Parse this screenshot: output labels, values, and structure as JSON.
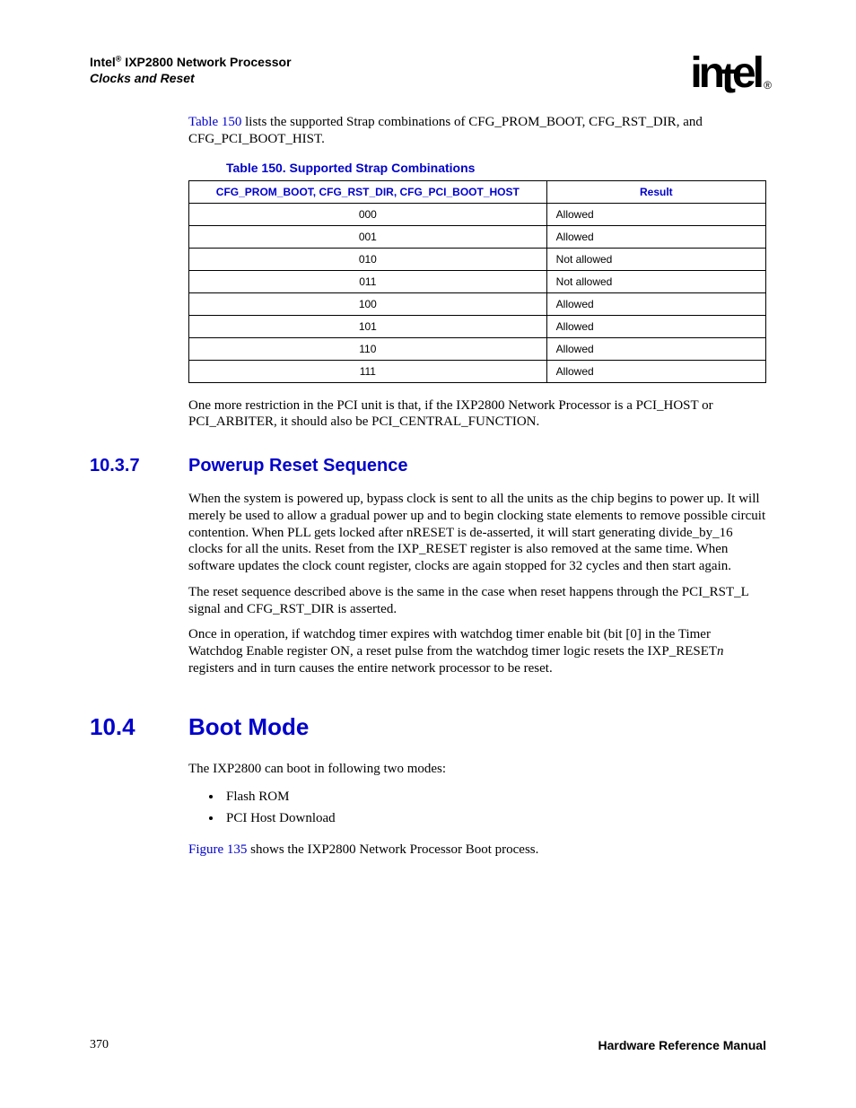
{
  "header": {
    "line1_prefix": "Intel",
    "line1_sup": "®",
    "line1_rest": " IXP2800 Network Processor",
    "line2": "Clocks and Reset"
  },
  "logo": {
    "text": "intel",
    "reg": "®"
  },
  "intro": {
    "ref": "Table 150",
    "rest": " lists the supported Strap combinations of CFG_PROM_BOOT, CFG_RST_DIR, and CFG_PCI_BOOT_HIST."
  },
  "table": {
    "caption": "Table 150. Supported Strap Combinations",
    "headers": [
      "CFG_PROM_BOOT, CFG_RST_DIR, CFG_PCI_BOOT_HOST",
      "Result"
    ],
    "rows": [
      [
        "000",
        "Allowed"
      ],
      [
        "001",
        "Allowed"
      ],
      [
        "010",
        "Not allowed"
      ],
      [
        "011",
        "Not allowed"
      ],
      [
        "100",
        "Allowed"
      ],
      [
        "101",
        "Allowed"
      ],
      [
        "110",
        "Allowed"
      ],
      [
        "111",
        "Allowed"
      ]
    ]
  },
  "para_after_table": "One more restriction in the PCI unit is that, if the IXP2800 Network Processor is a PCI_HOST or PCI_ARBITER, it should also be PCI_CENTRAL_FUNCTION.",
  "sec1037": {
    "num": "10.3.7",
    "title": "Powerup Reset Sequence",
    "p1": "When the system is powered up, bypass clock is sent to all the units as the chip begins to power up. It will merely be used to allow a gradual power up and to begin clocking state elements to remove possible circuit contention. When PLL gets locked after nRESET is de-asserted, it will start generating divide_by_16 clocks for all the units. Reset from the IXP_RESET register is also removed at the same time. When software updates the clock count register, clocks are again stopped for 32 cycles and then start again.",
    "p2": "The reset sequence described above is the same in the case when reset happens through the PCI_RST_L signal and CFG_RST_DIR is asserted.",
    "p3_a": "Once in operation, if watchdog timer expires with watchdog timer enable bit (bit [0] in the Timer Watchdog Enable register ON, a reset pulse from the watchdog timer logic resets the IXP_RESET",
    "p3_n": "n",
    "p3_b": " registers and in turn causes the entire network processor to be reset."
  },
  "sec104": {
    "num": "10.4",
    "title": "Boot Mode",
    "intro": "The IXP2800 can boot in following two modes:",
    "items": [
      "Flash ROM",
      "PCI Host Download"
    ],
    "fig_ref": "Figure 135",
    "fig_rest": " shows the IXP2800 Network Processor Boot process."
  },
  "footer": {
    "page": "370",
    "doc": "Hardware Reference Manual"
  }
}
